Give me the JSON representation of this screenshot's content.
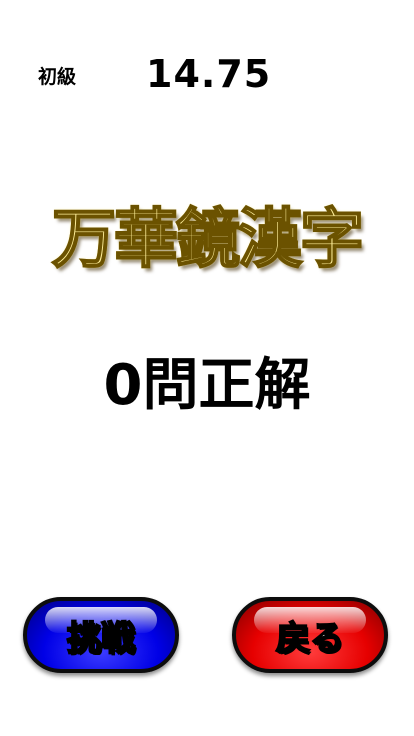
{
  "header": {
    "level": "初級",
    "time": "14.75"
  },
  "title": "万華鏡漢字",
  "result": "0問正解",
  "buttons": {
    "challenge": "挑戦",
    "back": "戻る"
  },
  "colors": {
    "title_gold": "#c9a52c",
    "challenge_button": "#0000e6",
    "back_button": "#e60000"
  }
}
